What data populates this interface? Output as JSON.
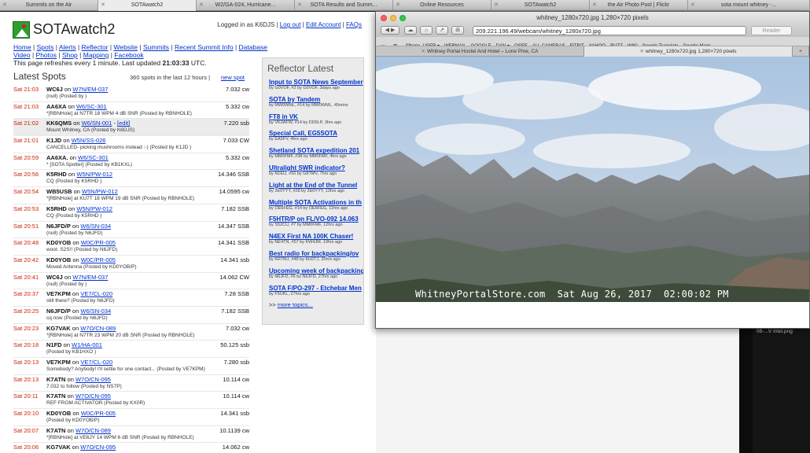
{
  "back_tabs": [
    {
      "label": "Summits on the Air"
    },
    {
      "label": "SOTAwatch2",
      "active": true
    },
    {
      "label": "W2/GA-024, Hurricane..."
    },
    {
      "label": "SOTA Results and Summ..."
    },
    {
      "label": "Online Resources"
    },
    {
      "label": "SOTAwatch2"
    },
    {
      "label": "the Air Photo Pool | Flickr"
    },
    {
      "label": "sota mount whitney -..."
    }
  ],
  "sota": {
    "site_title": "SOTAwatch2",
    "login": {
      "prefix": "Logged in as K6DJS",
      "logout": "Log out",
      "edit_account": "Edit Account",
      "faqs": "FAQs"
    },
    "nav_row1": [
      "Home",
      "Spots",
      "Alerts",
      "Reflector",
      "Website",
      "Summits",
      "Recent Summit Info",
      "Database"
    ],
    "nav_row2": [
      "Video",
      "Photos",
      "Shop",
      "Mapping",
      "Facebook"
    ],
    "refresh_text": "This page refreshes every 1 minute. Last updated",
    "refresh_time": "21:03:33",
    "refresh_suffix": "UTC.",
    "spots_title": "Latest Spots",
    "spots_count": "360 spots in the last 12 hours |",
    "new_spot": "new spot",
    "spots": [
      {
        "time": "Sat 21:03",
        "call": "WC6J",
        "ref": "W7N/EM-037",
        "freq": "7.032 cw",
        "comment": "(null) (Posted by )"
      },
      {
        "time": "Sat 21:03",
        "call": "AA6XA",
        "ref": "W6/SC-301",
        "freq": "5.332 cw",
        "comment": "*[RBNHole] at N7TR 18 WPM 4 dB SNR (Posted by RBNHOLE)"
      },
      {
        "time": "Sat 21:02",
        "call": "KK6QMS",
        "ref": "W6/SN-001",
        "edit": "[edit]",
        "freq": "7.220 ssb",
        "comment": "Mount Whitney, CA (Posted by K6DJS)",
        "highlight": true
      },
      {
        "time": "Sat 21:01",
        "call": "K1JD",
        "ref": "W5N/SS-026",
        "freq": "7.033 CW",
        "comment": "CANCELLED- picking mushrooms instead :-) (Posted by K1JD )"
      },
      {
        "time": "Sat 20:59",
        "call": "AA6XA.",
        "ref": "W6/SC-301",
        "freq": "5.332 cw",
        "comment": "* [SOTA Spotter] (Posted by KB1KXL)"
      },
      {
        "time": "Sat 20:56",
        "call": "K5RHD",
        "ref": "W5N/PW-012",
        "freq": "14.346 SSB",
        "comment": "CQ (Posted by K5RHD )"
      },
      {
        "time": "Sat 20:54",
        "call": "WB5USB",
        "ref": "W5N/PW-012",
        "freq": "14.0595 cw",
        "comment": "*[RBNHole] at KU7T 18 WPM 19 dB SNR (Posted by RBNHOLE)"
      },
      {
        "time": "Sat 20:53",
        "call": "K5RHD",
        "ref": "W5N/PW-012",
        "freq": "7.182 SSB",
        "comment": "CQ (Posted by K5RHD )"
      },
      {
        "time": "Sat 20:51",
        "call": "N6JFD/P",
        "ref": "W6/SN-034",
        "freq": "14.347 SSB",
        "comment": "(null) (Posted by N6JFD)"
      },
      {
        "time": "Sat 20:48",
        "call": "KD0YOB",
        "ref": "W0C/PR-005",
        "freq": "14.341 SSB",
        "comment": "woot. S2S!! (Posted by N6JFD)"
      },
      {
        "time": "Sat 20:42",
        "call": "KD0YOB",
        "ref": "W0C/PR-005",
        "freq": "14.341 ssb",
        "comment": "Moved Antenna (Posted by KD0YOB/P)"
      },
      {
        "time": "Sat 20:41",
        "call": "WC6J",
        "ref": "W7N/EM-037",
        "freq": "14.062 CW",
        "comment": "(null) (Posted by )"
      },
      {
        "time": "Sat 20:37",
        "call": "VE7KPM",
        "ref": "VE7/CL-020",
        "freq": "7.28 SSB",
        "comment": "still there? (Posted by N6JFD)"
      },
      {
        "time": "Sat 20:25",
        "call": "N6JFD/P",
        "ref": "W6/SN-034",
        "freq": "7.182 SSB",
        "comment": "cq now (Posted by N6JFD)"
      },
      {
        "time": "Sat 20:23",
        "call": "KG7VAK",
        "ref": "W7O/CN-089",
        "freq": "7.032 cw",
        "comment": "*[RBNHole] at N7TR 23 WPM 20 dB SNR (Posted by RBNHOLE)"
      },
      {
        "time": "Sat 20:18",
        "call": "N1FD",
        "ref": "W1/HA-001",
        "freq": "50.125 ssb",
        "comment": "(Posted by KB1HXO )"
      },
      {
        "time": "Sat 20:13",
        "call": "VE7KPM",
        "ref": "VE7/CL-020",
        "freq": "7.280 ssb",
        "comment": "Somebody? Anybody! I'll settle for one contact... (Posted by VE7KPM)"
      },
      {
        "time": "Sat 20:13",
        "call": "K7ATN",
        "ref": "W7O/CN-095",
        "freq": "10.114 cw",
        "comment": "7.032 to follow (Posted by NS7P)"
      },
      {
        "time": "Sat 20:11",
        "call": "K7ATN",
        "ref": "W7O/CN-095",
        "freq": "10.114 cw",
        "comment": "REF FROM ACTIVATOR (Posted by KX0R)"
      },
      {
        "time": "Sat 20:10",
        "call": "KD0YOB",
        "ref": "W0C/PR-005",
        "freq": "14.341 ssb",
        "comment": "(Posted by KD0YOB/P)"
      },
      {
        "time": "Sat 20:07",
        "call": "K7ATN",
        "ref": "W7O/CN-089",
        "freq": "10.1139 cw",
        "comment": "*[RBNHole] at VE6JY 14 WPM 6 dB SNR (Posted by RBNHOLE)"
      },
      {
        "time": "Sat 20:06",
        "call": "KG7VAK",
        "ref": "W7O/CN-095",
        "freq": "14.062 cw",
        "comment": ""
      }
    ],
    "reflector": {
      "title": "Reflector Latest",
      "items": [
        {
          "title": "Input to SOTA News September",
          "meta": "by G0VOF, #2 by G0VOF, 3days ago"
        },
        {
          "title": "SOTA by Tandem",
          "meta": "by MW0WML, #14 by MW0WML, 45mins"
        },
        {
          "title": "FT8 in VK",
          "meta": "by VK3AFW, #14 by DD5LP, 3hrs ago"
        },
        {
          "title": "Special Call, EG5SOTA",
          "meta": "by EA5FV, 4hrs ago"
        },
        {
          "title": "Shetland SOTA expedition 201",
          "meta": "by MM0FMF, #38 by MM0FMF, 4hrs ago"
        },
        {
          "title": "Ultralight SWR indicator?",
          "meta": "by N1EU, #16 by G8TMV, 7hrs ago"
        },
        {
          "title": "Light at the End of the Tunnel",
          "meta": "by 2E0YYY, #28 by 2E0YYY, 13hrs ago"
        },
        {
          "title": "Multiple SOTA Activations in th",
          "meta": "by OE6FEG, #14 by OE6FEG, 11hrs ago"
        },
        {
          "title": "F5HTR/P on FL/VO-092 14.063",
          "meta": "by S52CU, #7 by MM0FMF, 12hrs ago"
        },
        {
          "title": "N4EX First NA 100K Chaser!",
          "meta": "by NE4TN, #57 by KW4JM, 19hrs ago"
        },
        {
          "title": "Best radio for backpacking/ov",
          "meta": "by KR7MJ, #48 by KH2TJ, 20hrs ago"
        },
        {
          "title": "Upcoming week of backpacking",
          "meta": "by N6JFD, #6 by N6JFD, 27hrs ago"
        },
        {
          "title": "SOTA F/PO-297 - Etchebar Men",
          "meta": "by F5UKL, 27hrs ago"
        }
      ],
      "more_prefix": ">>",
      "more": "more topics..."
    }
  },
  "safari": {
    "title": "whitney_1280x720.jpg 1,280×720 pixels",
    "url": "209.221.196.49/webcam/whitney_1280x720.jpg",
    "reader": "Reader",
    "bookmarks": [
      "iPhone_USER ▾",
      "WEBMAIL",
      "GOOGLE",
      "DAN ▾",
      "QSEE",
      "ALL CAMERAS",
      "FITBIT",
      "YAHOO",
      "BUZZ",
      "WIKI",
      "Google Translate",
      "Google Maps"
    ],
    "tabs": [
      {
        "label": "Whitney Portal Hostel And Hotel – Lone Pine, CA"
      },
      {
        "label": "whitney_1280x720.jpg 1,280×720 pixels",
        "active": true
      }
    ],
    "webcam_caption": "WhitneyPortalStore.com  Sat Aug 26, 2017  02:00:02 PM"
  },
  "desktop": {
    "file_label": "08-...V Intel.png"
  },
  "colors": {
    "spot_time": "#cc2200",
    "link": "#0033cc",
    "logo_green": "#2f9e2f",
    "sky": "#b9cde4"
  }
}
